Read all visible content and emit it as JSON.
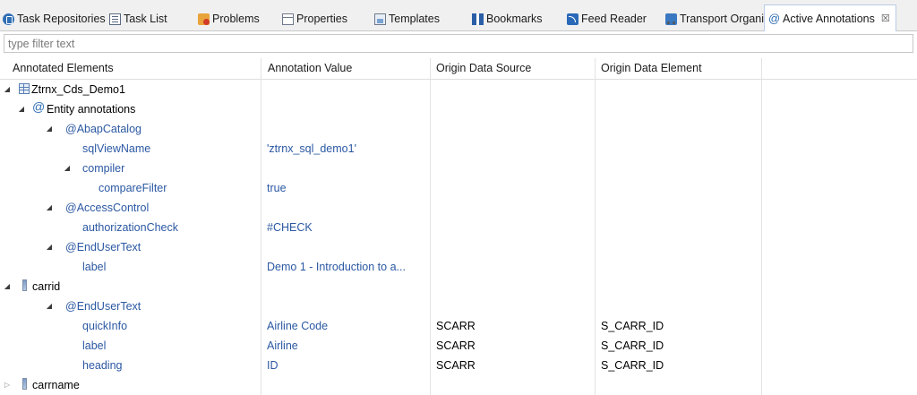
{
  "tabs": [
    {
      "label": "Task Repositories",
      "icon": "task-repositories-icon",
      "active": false
    },
    {
      "label": "Task List",
      "icon": "task-list-icon",
      "active": false
    },
    {
      "label": "Problems",
      "icon": "problems-icon",
      "active": false
    },
    {
      "label": "Properties",
      "icon": "properties-icon",
      "active": false
    },
    {
      "label": "Templates",
      "icon": "templates-icon",
      "active": false
    },
    {
      "label": "Bookmarks",
      "icon": "bookmarks-icon",
      "active": false
    },
    {
      "label": "Feed Reader",
      "icon": "feed-reader-icon",
      "active": false
    },
    {
      "label": "Transport Organizer",
      "icon": "transport-organizer-icon",
      "active": false
    },
    {
      "label": "Active Annotations",
      "icon": "at-sign-icon",
      "active": true,
      "close": "☒"
    }
  ],
  "filter": {
    "placeholder": "type filter text",
    "value": ""
  },
  "columns": [
    "Annotated Elements",
    "Annotation Value",
    "Origin Data Source",
    "Origin Data Element"
  ],
  "rows": [
    {
      "label": "Ztrnx_Cds_Demo1",
      "level": 0,
      "twisty": "expanded",
      "icon": "table-icon",
      "style": "black",
      "value": "",
      "source": "",
      "element": ""
    },
    {
      "label": "Entity annotations",
      "level": 1,
      "twisty": "expanded",
      "icon": "at-sign-icon",
      "style": "black",
      "value": "",
      "source": "",
      "element": ""
    },
    {
      "label": "@AbapCatalog",
      "level": 2,
      "twisty": "expanded",
      "icon": "",
      "style": "blue",
      "value": "",
      "source": "",
      "element": ""
    },
    {
      "label": "sqlViewName",
      "level": 3,
      "twisty": "",
      "icon": "",
      "style": "blue",
      "value": "'ztrnx_sql_demo1'",
      "source": "",
      "element": ""
    },
    {
      "label": "compiler",
      "level": 3,
      "twisty": "expanded",
      "icon": "",
      "style": "blue",
      "value": "",
      "source": "",
      "element": ""
    },
    {
      "label": "compareFilter",
      "level": 4,
      "twisty": "",
      "icon": "",
      "style": "blue",
      "value": "true",
      "source": "",
      "element": ""
    },
    {
      "label": "@AccessControl",
      "level": 2,
      "twisty": "expanded",
      "icon": "",
      "style": "blue",
      "value": "",
      "source": "",
      "element": ""
    },
    {
      "label": "authorizationCheck",
      "level": 3,
      "twisty": "",
      "icon": "",
      "style": "blue",
      "value": "#CHECK",
      "source": "",
      "element": ""
    },
    {
      "label": "@EndUserText",
      "level": 2,
      "twisty": "expanded",
      "icon": "",
      "style": "blue",
      "value": "",
      "source": "",
      "element": ""
    },
    {
      "label": "label",
      "level": 3,
      "twisty": "",
      "icon": "",
      "style": "blue",
      "value": "Demo 1 - Introduction to a...",
      "source": "",
      "element": ""
    },
    {
      "label": "carrid",
      "level": 0,
      "twisty": "expanded",
      "icon": "field-icon",
      "style": "black",
      "value": "",
      "source": "",
      "element": ""
    },
    {
      "label": "@EndUserText",
      "level": 2,
      "twisty": "expanded",
      "icon": "",
      "style": "blue",
      "value": "",
      "source": "",
      "element": ""
    },
    {
      "label": "quickInfo",
      "level": 3,
      "twisty": "",
      "icon": "",
      "style": "blue",
      "value": "Airline Code",
      "source": "SCARR",
      "element": "S_CARR_ID"
    },
    {
      "label": "label",
      "level": 3,
      "twisty": "",
      "icon": "",
      "style": "blue",
      "value": "Airline",
      "source": "SCARR",
      "element": "S_CARR_ID"
    },
    {
      "label": "heading",
      "level": 3,
      "twisty": "",
      "icon": "",
      "style": "blue",
      "value": "ID",
      "source": "SCARR",
      "element": "S_CARR_ID"
    },
    {
      "label": "carrname",
      "level": 0,
      "twisty": "collapsed",
      "icon": "field-icon",
      "style": "black",
      "value": "",
      "source": "",
      "element": ""
    }
  ],
  "colors": {
    "annotation_text": "#2b58a3",
    "active_tab_border": "#b9cde5"
  }
}
